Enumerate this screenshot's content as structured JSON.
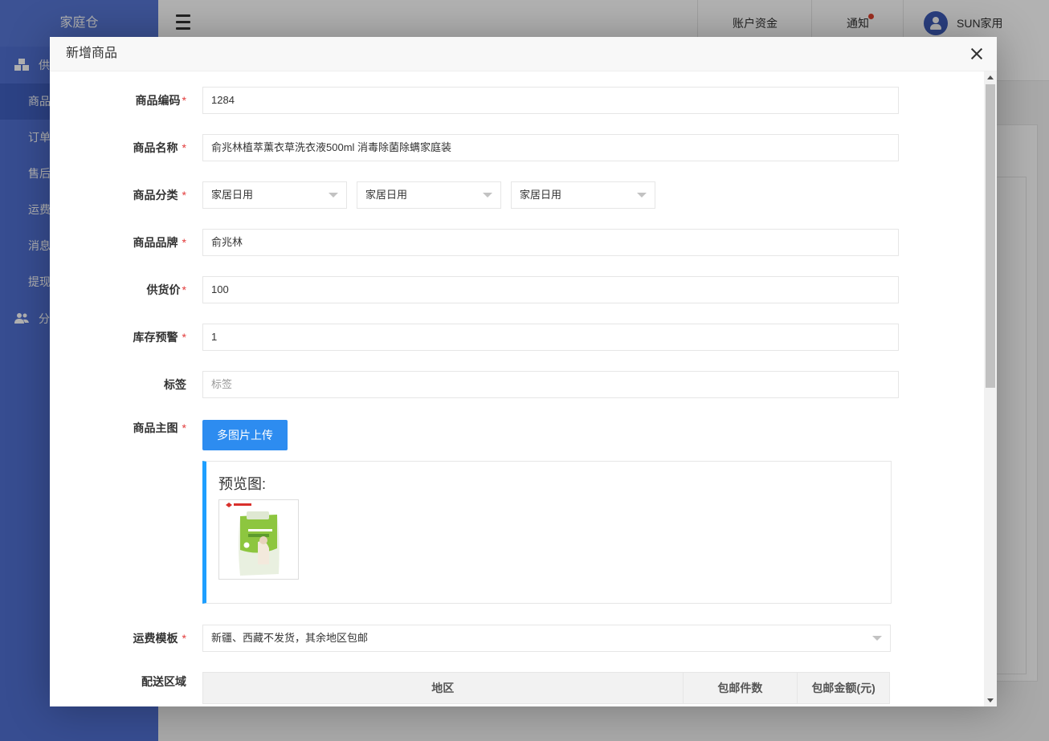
{
  "sidebar": {
    "logo": "家庭仓",
    "groups": [
      {
        "label": "供",
        "icon": "cubes-icon"
      },
      {
        "label": "分",
        "icon": "users-icon"
      }
    ],
    "items": [
      "商品",
      "订单",
      "售后",
      "运费",
      "消息",
      "提现"
    ],
    "active_index": 0
  },
  "topbar": {
    "funds": "账户资金",
    "notify": "通知",
    "user": "SUN家用"
  },
  "modal": {
    "title": "新增商品",
    "fields": {
      "code": {
        "label": "商品编码",
        "value": "1284"
      },
      "name": {
        "label": "商品名称",
        "value": "俞兆林植萃薰衣草洗衣液500ml 消毒除菌除螨家庭装"
      },
      "category": {
        "label": "商品分类",
        "values": [
          "家居日用",
          "家居日用",
          "家居日用"
        ]
      },
      "brand": {
        "label": "商品品牌",
        "value": "俞兆林"
      },
      "price": {
        "label": "供货价",
        "value": "100"
      },
      "stock_alert": {
        "label": "库存预警",
        "value": "1"
      },
      "tags": {
        "label": "标签",
        "placeholder": "标签"
      },
      "main_image": {
        "label": "商品主图",
        "upload_label": "多图片上传",
        "preview_title": "预览图:"
      },
      "shipping": {
        "label": "运费模板",
        "value": "新疆、西藏不发货，其余地区包邮"
      },
      "delivery": {
        "label": "配送区域",
        "columns": [
          "地区",
          "包邮件数",
          "包邮金额(元)"
        ]
      }
    },
    "required_mark": "*"
  },
  "colors": {
    "sidebar": "#4f6fd0",
    "primary_button": "#2d8cf0",
    "preview_accent": "#1e9fff",
    "required": "#e23b3b",
    "product_green": "#8dc63f"
  }
}
